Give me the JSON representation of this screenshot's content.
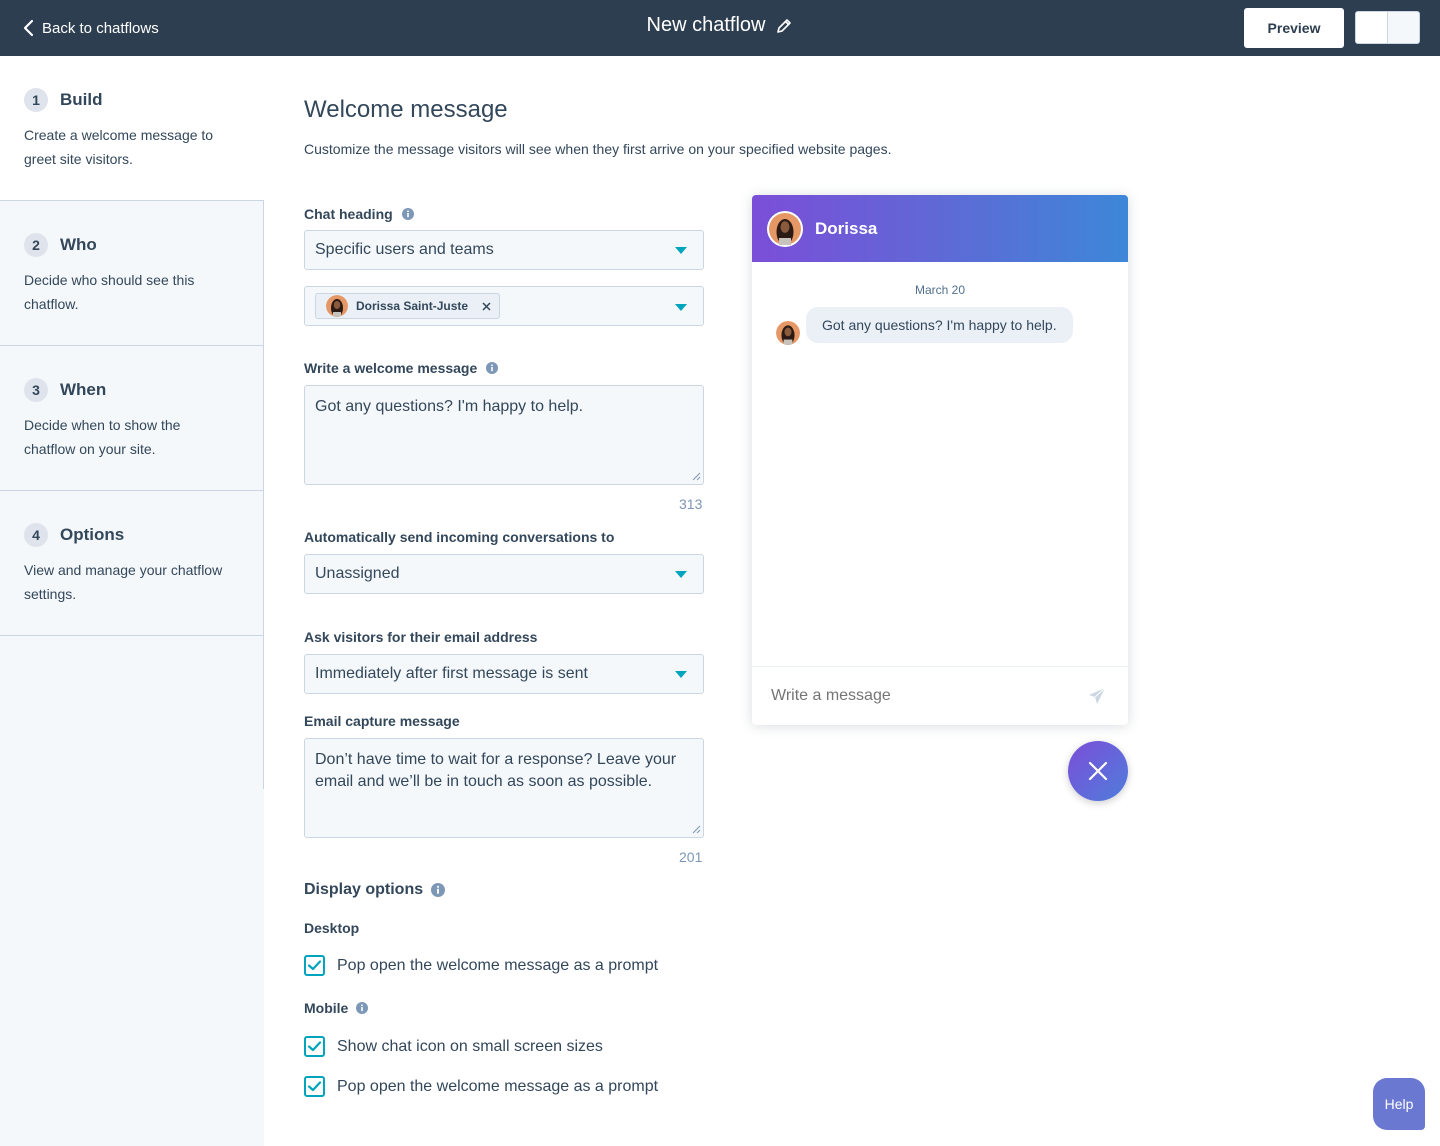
{
  "header": {
    "back_label": "Back to chatflows",
    "title": "New chatflow",
    "preview_label": "Preview"
  },
  "steps": [
    {
      "number": "1",
      "title": "Build",
      "description": "Create a welcome message to greet site visitors."
    },
    {
      "number": "2",
      "title": "Who",
      "description": "Decide who should see this chatflow."
    },
    {
      "number": "3",
      "title": "When",
      "description": "Decide when to show the chatflow on your site."
    },
    {
      "number": "4",
      "title": "Options",
      "description": "View and manage your chatflow settings."
    }
  ],
  "main": {
    "title": "Welcome message",
    "subtitle": "Customize the message visitors will see when they first arrive on your specified website pages.",
    "chat_heading_label": "Chat heading",
    "chat_heading_value": "Specific users and teams",
    "selected_user": "Dorissa Saint-Juste",
    "welcome_label": "Write a welcome message",
    "welcome_value": "Got any questions? I'm happy to help.",
    "welcome_counter": "313",
    "auto_send_label": "Automatically send incoming conversations to",
    "auto_send_value": "Unassigned",
    "ask_email_label": "Ask visitors for their email address",
    "ask_email_value": "Immediately after first message is sent",
    "email_capture_label": "Email capture message",
    "email_capture_value": "Don’t have time to wait for a response? Leave your email and we’ll be in touch as soon as possible.",
    "email_capture_counter": "201",
    "display_options_title": "Display options",
    "desktop_label": "Desktop",
    "desktop_popup": "Pop open the welcome message as a prompt",
    "mobile_label": "Mobile",
    "mobile_show_icon": "Show chat icon on small screen sizes",
    "mobile_popup": "Pop open the welcome message as a prompt"
  },
  "widget": {
    "agent_name": "Dorissa",
    "date": "March 20",
    "message": "Got any questions? I'm happy to help.",
    "input_placeholder": "Write a message"
  },
  "help_label": "Help",
  "colors": {
    "topbar": "#2d3e50",
    "checkbox_accent": "#00a4bd",
    "caret": "#00a4bd",
    "header_gradient_start": "#7b4ed8",
    "header_gradient_end": "#3d87d8",
    "help_button": "#6a78d1"
  },
  "icons": [
    "chevron-left-icon",
    "pencil-icon",
    "info-icon",
    "caret-down-icon",
    "close-x-icon",
    "check-icon",
    "send-icon"
  ]
}
